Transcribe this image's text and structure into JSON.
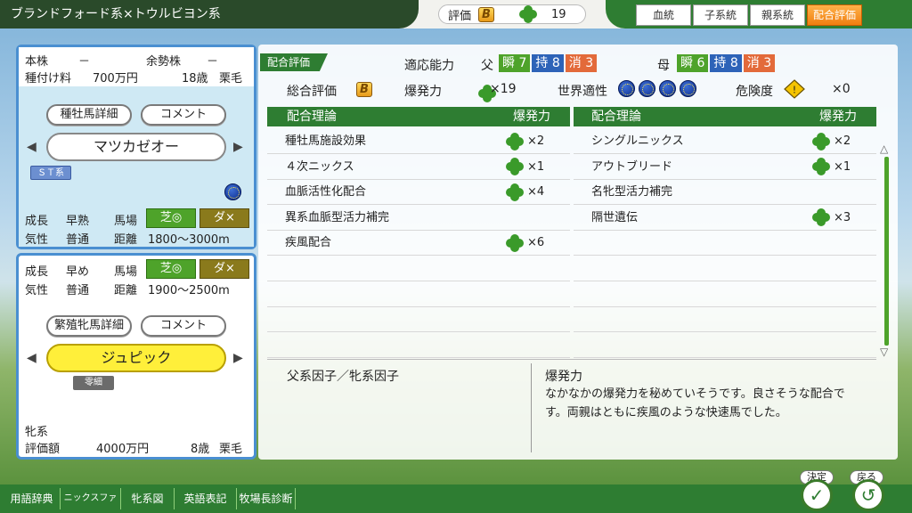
{
  "header": {
    "title": "ブランドフォード系×トウルビヨン系",
    "eval_label": "評価",
    "grade": "B",
    "clover_count": "19"
  },
  "tabs": [
    {
      "label": "血統"
    },
    {
      "label": "子系統"
    },
    {
      "label": "親系統"
    },
    {
      "label": "配合評価",
      "active": true
    }
  ],
  "sire": {
    "honkabu_label": "本株",
    "honkabu_val": "－",
    "yosei_label": "余勢株",
    "yosei_val": "－",
    "fee_label": "種付け料",
    "fee_val": "700万円",
    "age": "18歳",
    "coat": "栗毛",
    "detail_btn": "種牡馬詳細",
    "comment_btn": "コメント",
    "name": "マツカゼオー",
    "st_tag": "ＳＴ系",
    "growth_label": "成長",
    "growth_val": "早熟",
    "track_label": "馬場",
    "turf_tag": "芝◎",
    "dirt_tag": "ダ×",
    "temper_label": "気性",
    "temper_val": "普通",
    "dist_label": "距離",
    "dist_val": "1800〜3000m"
  },
  "dam": {
    "growth_label": "成長",
    "growth_val": "早め",
    "track_label": "馬場",
    "turf_tag": "芝◎",
    "dirt_tag": "ダ×",
    "temper_label": "気性",
    "temper_val": "普通",
    "dist_label": "距離",
    "dist_val": "1900〜2500m",
    "detail_btn": "繁殖牝馬詳細",
    "comment_btn": "コメント",
    "name": "ジュピック",
    "small_tag": "零細",
    "line_label": "牝系",
    "price_label": "評価額",
    "price_val": "4000万円",
    "age": "8歳",
    "coat": "栗毛"
  },
  "main": {
    "section_tag": "配合評価",
    "ability_label": "適応能力",
    "father_label": "父",
    "mother_label": "母",
    "father_stats": [
      {
        "k": "瞬",
        "v": "7"
      },
      {
        "k": "持",
        "v": "8"
      },
      {
        "k": "消",
        "v": "3"
      }
    ],
    "mother_stats": [
      {
        "k": "瞬",
        "v": "6"
      },
      {
        "k": "持",
        "v": "8"
      },
      {
        "k": "消",
        "v": "3"
      }
    ],
    "total_label": "総合評価",
    "total_grade": "B",
    "burst_label": "爆発力",
    "burst_val": "×19",
    "world_label": "世界適性",
    "danger_label": "危険度",
    "danger_val": "×0",
    "col_theory": "配合理論",
    "col_burst": "爆発力",
    "left_rows": [
      {
        "name": "種牡馬施設効果",
        "mult": "×2"
      },
      {
        "name": "４次ニックス",
        "mult": "×1"
      },
      {
        "name": "血脈活性化配合",
        "mult": "×4"
      },
      {
        "name": "異系血脈型活力補完",
        "mult": ""
      },
      {
        "name": "疾風配合",
        "mult": "×6"
      }
    ],
    "right_rows": [
      {
        "name": "シングルニックス",
        "mult": "×2"
      },
      {
        "name": "アウトブリード",
        "mult": "×1"
      },
      {
        "name": "名牝型活力補完",
        "mult": ""
      },
      {
        "name": "隔世遺伝",
        "mult": "×3"
      }
    ],
    "factor_label": "父系因子／牝系因子",
    "desc_title": "爆発力",
    "desc_text": "なかなかの爆発力を秘めていそうです。良さそうな配合です。両親はともに疾風のような快速馬でした。"
  },
  "bottom": {
    "items": [
      "用語辞典",
      "ニックスファイル",
      "牝系図",
      "英語表記",
      "牧場長診断"
    ],
    "ok_label": "決定",
    "back_label": "戻る"
  }
}
